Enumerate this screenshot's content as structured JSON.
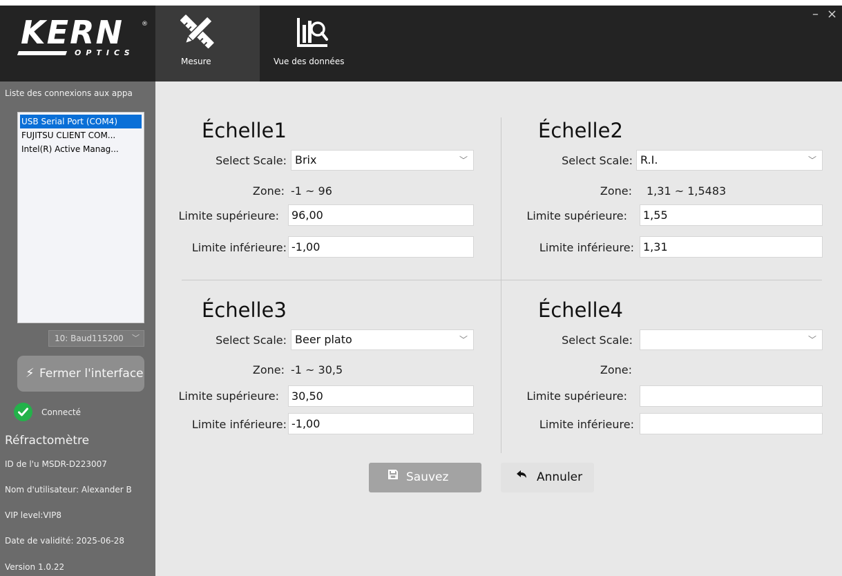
{
  "window": {
    "minimize": "–",
    "close": "×"
  },
  "logo": {
    "brand": "KERN",
    "registered": "®",
    "sub": "OPTICS"
  },
  "tabs": [
    {
      "label": "Mesure",
      "icon": "ruler-pencil-icon",
      "active": true
    },
    {
      "label": "Vue des données",
      "icon": "chart-search-icon",
      "active": false
    }
  ],
  "sidebar": {
    "connections_label": "Liste des connexions aux appa",
    "ports": [
      {
        "label": "USB Serial Port (COM4)",
        "selected": true
      },
      {
        "label": "FUJITSU CLIENT COM...",
        "selected": false
      },
      {
        "label": "Intel(R) Active Manag...",
        "selected": false
      }
    ],
    "baud": "10:  Baud115200",
    "close_button": "Fermer l'interface",
    "status": "Connecté",
    "status_color": "#23b24a",
    "device_title": "Réfractomètre",
    "info": [
      "ID de l'u MSDR-D223007",
      "Nom d'utilisateur: Alexander B",
      "VIP level:VIP8",
      "Date de validité: 2025-06-28",
      "Version 1.0.22"
    ]
  },
  "labels": {
    "select_scale": "Select Scale:",
    "zone": "Zone:",
    "upper": "Limite supérieure:",
    "lower": "Limite inférieure:"
  },
  "scales": [
    {
      "title": "Échelle1",
      "scale": "Brix",
      "zone": "-1 ~ 96",
      "upper": "96,00",
      "lower": "-1,00"
    },
    {
      "title": "Échelle2",
      "scale": "R.I.",
      "zone": "1,31 ~ 1,5483",
      "upper": "1,55",
      "lower": "1,31"
    },
    {
      "title": "Échelle3",
      "scale": "Beer plato",
      "zone": "-1 ~ 30,5",
      "upper": "30,50",
      "lower": "-1,00"
    },
    {
      "title": "Échelle4",
      "scale": "",
      "zone": "",
      "upper": "",
      "lower": ""
    }
  ],
  "actions": {
    "save": "Sauvez",
    "cancel": "Annuler"
  },
  "colors": {
    "accent": "#0a6fd7",
    "sidebar": "#6b6b6b",
    "header": "#232323"
  }
}
